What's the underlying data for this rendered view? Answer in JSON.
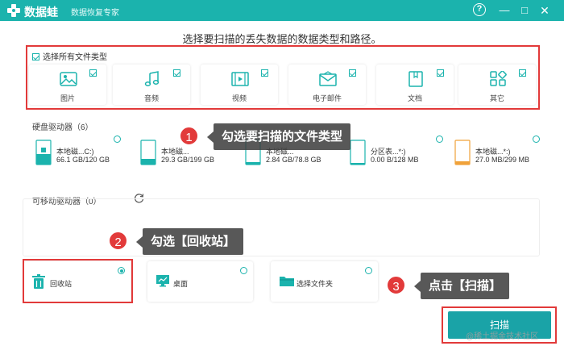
{
  "titlebar": {
    "app_name": "数据蛙",
    "subtitle": "数据恢复专家",
    "help_label": "?",
    "min_label": "—",
    "max_label": "□",
    "close_label": "✕"
  },
  "main_title": "选择要扫描的丢失数据的数据类型和路径。",
  "file_types": {
    "select_all_label": "选择所有文件类型",
    "items": [
      {
        "label": "图片",
        "icon": "image-icon"
      },
      {
        "label": "音频",
        "icon": "music-icon"
      },
      {
        "label": "视频",
        "icon": "video-icon"
      },
      {
        "label": "电子邮件",
        "icon": "mail-icon"
      },
      {
        "label": "文档",
        "icon": "document-icon"
      },
      {
        "label": "其它",
        "icon": "other-icon"
      }
    ]
  },
  "hard_drives": {
    "label": "硬盘驱动器（6）",
    "items": [
      {
        "name": "本地磁...C:)",
        "size": "66.1 GB/120 GB"
      },
      {
        "name": "本地磁...",
        "size": "29.3 GB/199 GB"
      },
      {
        "name": "本地磁...",
        "size": "2.84 GB/78.8 GB"
      },
      {
        "name": "分区表...*:)",
        "size": "0.00 B/128 MB"
      },
      {
        "name": "本地磁...*:)",
        "size": "27.0 MB/299 MB"
      }
    ]
  },
  "removable": {
    "label": "可移动驱动器（0）",
    "refresh_icon": "refresh-icon"
  },
  "locations": [
    {
      "label": "回收站",
      "icon": "trash-icon"
    },
    {
      "label": "桌面",
      "icon": "desktop-icon"
    },
    {
      "label": "选择文件夹",
      "icon": "folder-icon"
    }
  ],
  "callouts": [
    {
      "badge": "1",
      "text": "勾选要扫描的文件类型"
    },
    {
      "badge": "2",
      "text": "勾选【回收站】"
    },
    {
      "badge": "3",
      "text": "点击【扫描】"
    }
  ],
  "scan_button": "扫描",
  "watermark": "@稀土掘金技术社区",
  "colors": {
    "accent": "#1bb3ad",
    "annotation_red": "#e23a3a",
    "callout_bg": "#3c3c3c"
  }
}
